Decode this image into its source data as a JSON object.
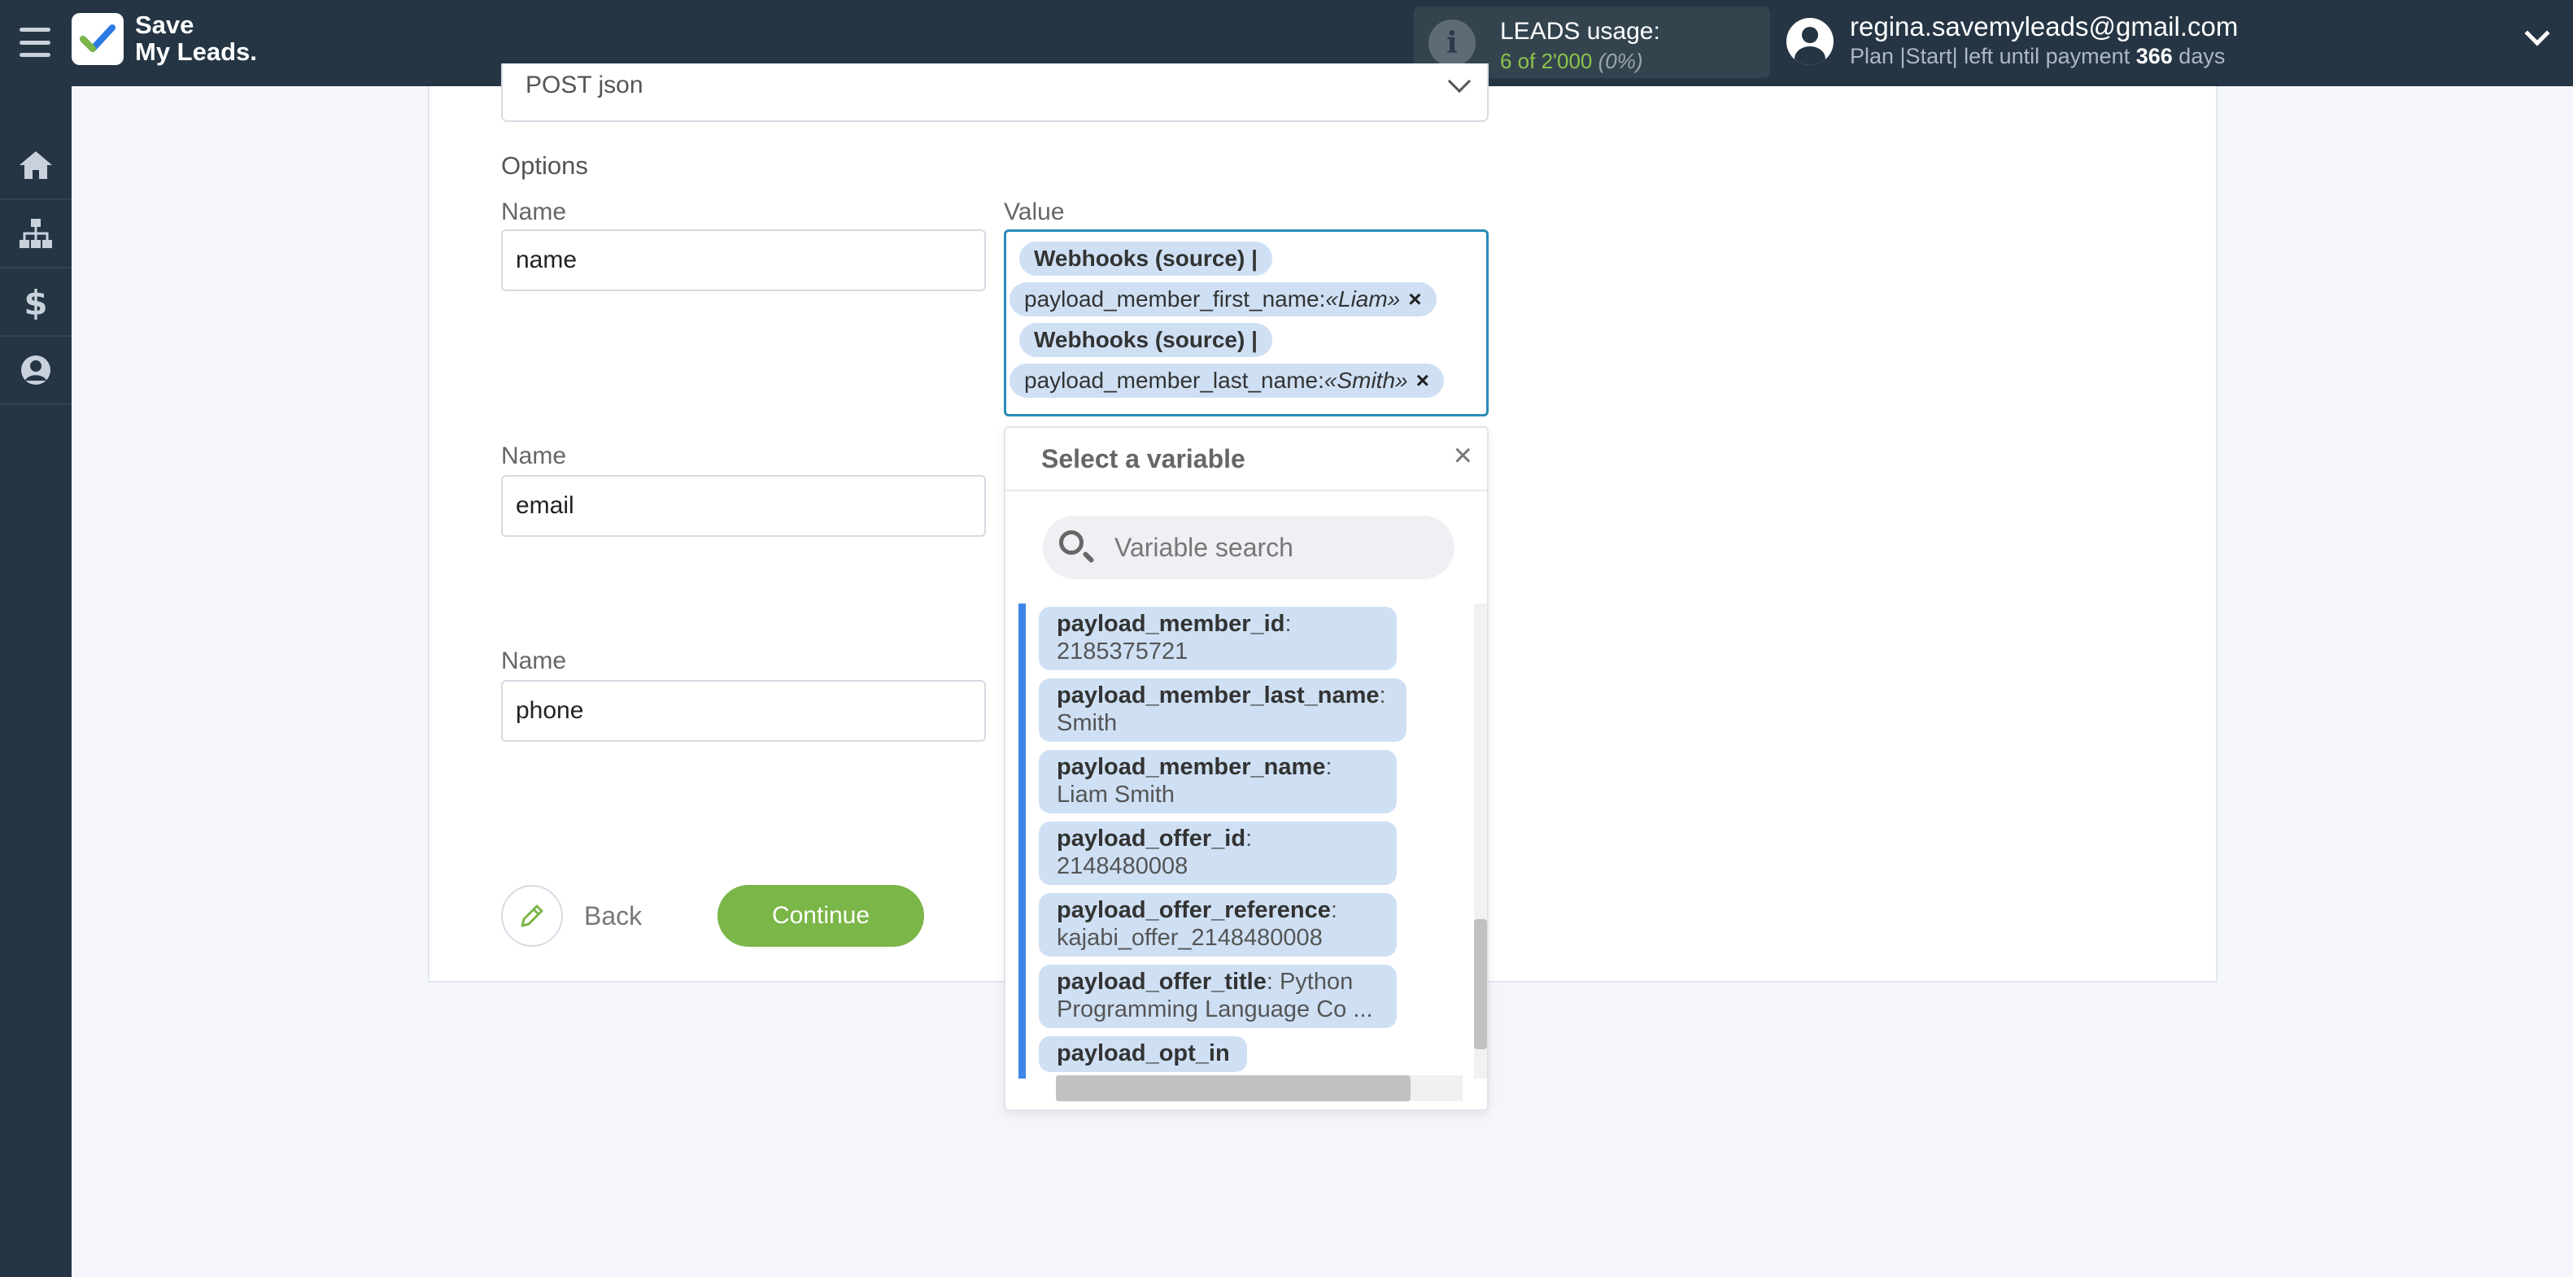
{
  "header": {
    "brand_line1": "Save",
    "brand_line2": "My Leads.",
    "usage_title": "LEADS usage:",
    "usage_count": "6 of 2'000",
    "usage_percent": "(0%)",
    "user_email": "regina.savemyleads@gmail.com",
    "plan_prefix": "Plan |Start| left until payment",
    "plan_days": "366",
    "plan_suffix": "days"
  },
  "sidebar": {
    "items": [
      {
        "icon": "home-icon"
      },
      {
        "icon": "sitemap-icon"
      },
      {
        "icon": "dollar-icon"
      },
      {
        "icon": "user-icon"
      }
    ]
  },
  "form": {
    "method_value": "POST json",
    "options_title": "Options",
    "name_label": "Name",
    "value_label": "Value",
    "rows": [
      {
        "name": "name"
      },
      {
        "name": "email"
      },
      {
        "name": "phone"
      }
    ],
    "value_tags": [
      {
        "source": "Webhooks (source) |",
        "field": "payload_member_first_name: ",
        "sample": "«Liam»",
        "remove": "×"
      },
      {
        "source": "Webhooks (source) |",
        "field": "payload_member_last_name: ",
        "sample": "«Smith»",
        "remove": "×"
      }
    ]
  },
  "variable_picker": {
    "title": "Select a variable",
    "close": "×",
    "search_placeholder": "Variable search",
    "items": [
      {
        "key": "payload_member_id",
        "sep": ":",
        "value": "2185375721"
      },
      {
        "key": "payload_member_last_name",
        "sep": ":",
        "value": "Smith"
      },
      {
        "key": "payload_member_name",
        "sep": ":",
        "value": "Liam Smith"
      },
      {
        "key": "payload_offer_id",
        "sep": ":",
        "value": "2148480008"
      },
      {
        "key": "payload_offer_reference",
        "sep": ":",
        "value": "kajabi_offer_2148480008"
      },
      {
        "key": "payload_offer_title",
        "sep": ": Python",
        "value": "Programming Language Co ..."
      },
      {
        "key": "payload_opt_in",
        "sep": "",
        "value": ""
      }
    ]
  },
  "buttons": {
    "back": "Back",
    "continue": "Continue"
  },
  "colors": {
    "topbar": "#253544",
    "accent_green": "#7ab648",
    "tag_bg": "#cfe0f4",
    "focus_border": "#2a8bb7",
    "list_accent": "#3d86e8"
  }
}
